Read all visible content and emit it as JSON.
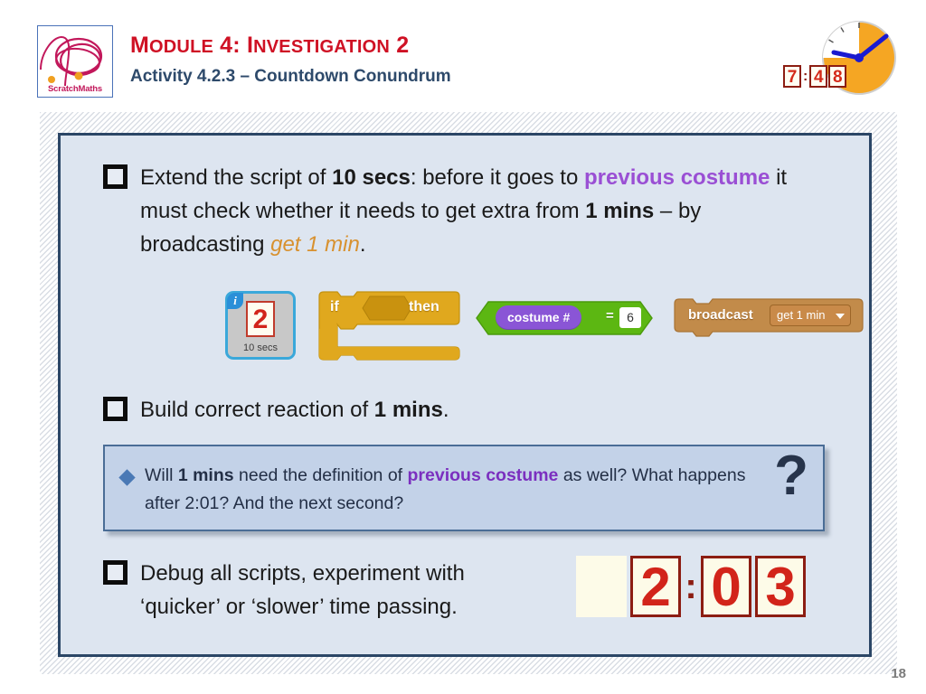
{
  "header": {
    "logo_text": "ScratchMaths",
    "title_main_parts": [
      "M",
      "ODULE",
      " 4: ",
      "I",
      "NVESTIGATION",
      " 2"
    ],
    "title_main": "MODULE 4: INVESTIGATION 2",
    "title_sub": "Activity 4.2.3 – Countdown Conundrum",
    "clock": {
      "digits": [
        "7",
        "4",
        "8"
      ],
      "separator": ":",
      "time": "7:48"
    },
    "colors": {
      "title_red": "#cf1124",
      "subtitle_navy": "#2e4a6b",
      "logo_crimson": "#c2185b",
      "logo_border_blue": "#4a72b8"
    }
  },
  "panel": {
    "background": "#dde5f0",
    "border": "#2b4666",
    "task1": {
      "checkbox_checked": false,
      "segments": [
        {
          "text": "Extend the script of ",
          "style": "normal"
        },
        {
          "text": "10 secs",
          "style": "bold"
        },
        {
          "text": ": before it goes to ",
          "style": "normal"
        },
        {
          "text": "previous costume",
          "style": "purple"
        },
        {
          "text": " it must check whether it needs to get extra from ",
          "style": "normal"
        },
        {
          "text": "1 mins",
          "style": "bold"
        },
        {
          "text": " – by broadcasting ",
          "style": "normal"
        },
        {
          "text": "get 1 min",
          "style": "orange-italic"
        },
        {
          "text": ".",
          "style": "normal"
        }
      ],
      "plain": "Extend the script of 10 secs: before it goes to previous costume it must check whether it needs to get extra from 1 mins – by broadcasting get 1 min."
    },
    "blocks": {
      "sprite": {
        "badge": "i",
        "thumbnail_number": "2",
        "label": "10 secs"
      },
      "if_block": {
        "if_label": "if",
        "then_label": "then",
        "color": "#e0a81e"
      },
      "costume_block": {
        "reporter_label": "costume  #",
        "operator": "=",
        "value": "6",
        "operator_color": "#5cb712",
        "reporter_color": "#8a55d6"
      },
      "broadcast_block": {
        "label": "broadcast",
        "dropdown_value": "get 1 min",
        "dropdown_arrow": "▼",
        "color": "#c28b4a"
      }
    },
    "task2": {
      "checkbox_checked": false,
      "segments": [
        {
          "text": "Build correct reaction of ",
          "style": "normal"
        },
        {
          "text": "1 mins",
          "style": "bold"
        },
        {
          "text": ".",
          "style": "normal"
        }
      ],
      "plain": "Build correct reaction of 1 mins."
    },
    "question_box": {
      "bullet": "diamond",
      "question_mark": "?",
      "segments": [
        {
          "text": "Will ",
          "style": "normal"
        },
        {
          "text": "1 mins",
          "style": "bold"
        },
        {
          "text": " need the definition of ",
          "style": "normal"
        },
        {
          "text": "previous costume",
          "style": "purple"
        },
        {
          "text": " as well? What happens after 2:01? And the next second?",
          "style": "normal"
        }
      ],
      "plain": "Will 1 mins need the definition of previous costume as well? What happens after 2:01? And the next second?",
      "background": "#c3d2e8",
      "border": "#4a6d96"
    },
    "task3": {
      "checkbox_checked": false,
      "line1": "Debug all scripts, experiment with",
      "line2": "‘quicker’ or ‘slower’ time passing.",
      "plain": "Debug all scripts, experiment with ‘quicker’ or ‘slower’ time passing."
    },
    "big_time": {
      "blank_box": "",
      "digits": [
        "2",
        "0",
        "3"
      ],
      "separator": ":",
      "time": "2:03",
      "digit_color": "#d2241a",
      "box_border": "#8c1d12",
      "box_fill": "#fdfbe8"
    }
  },
  "footer": {
    "page_number": "18"
  }
}
